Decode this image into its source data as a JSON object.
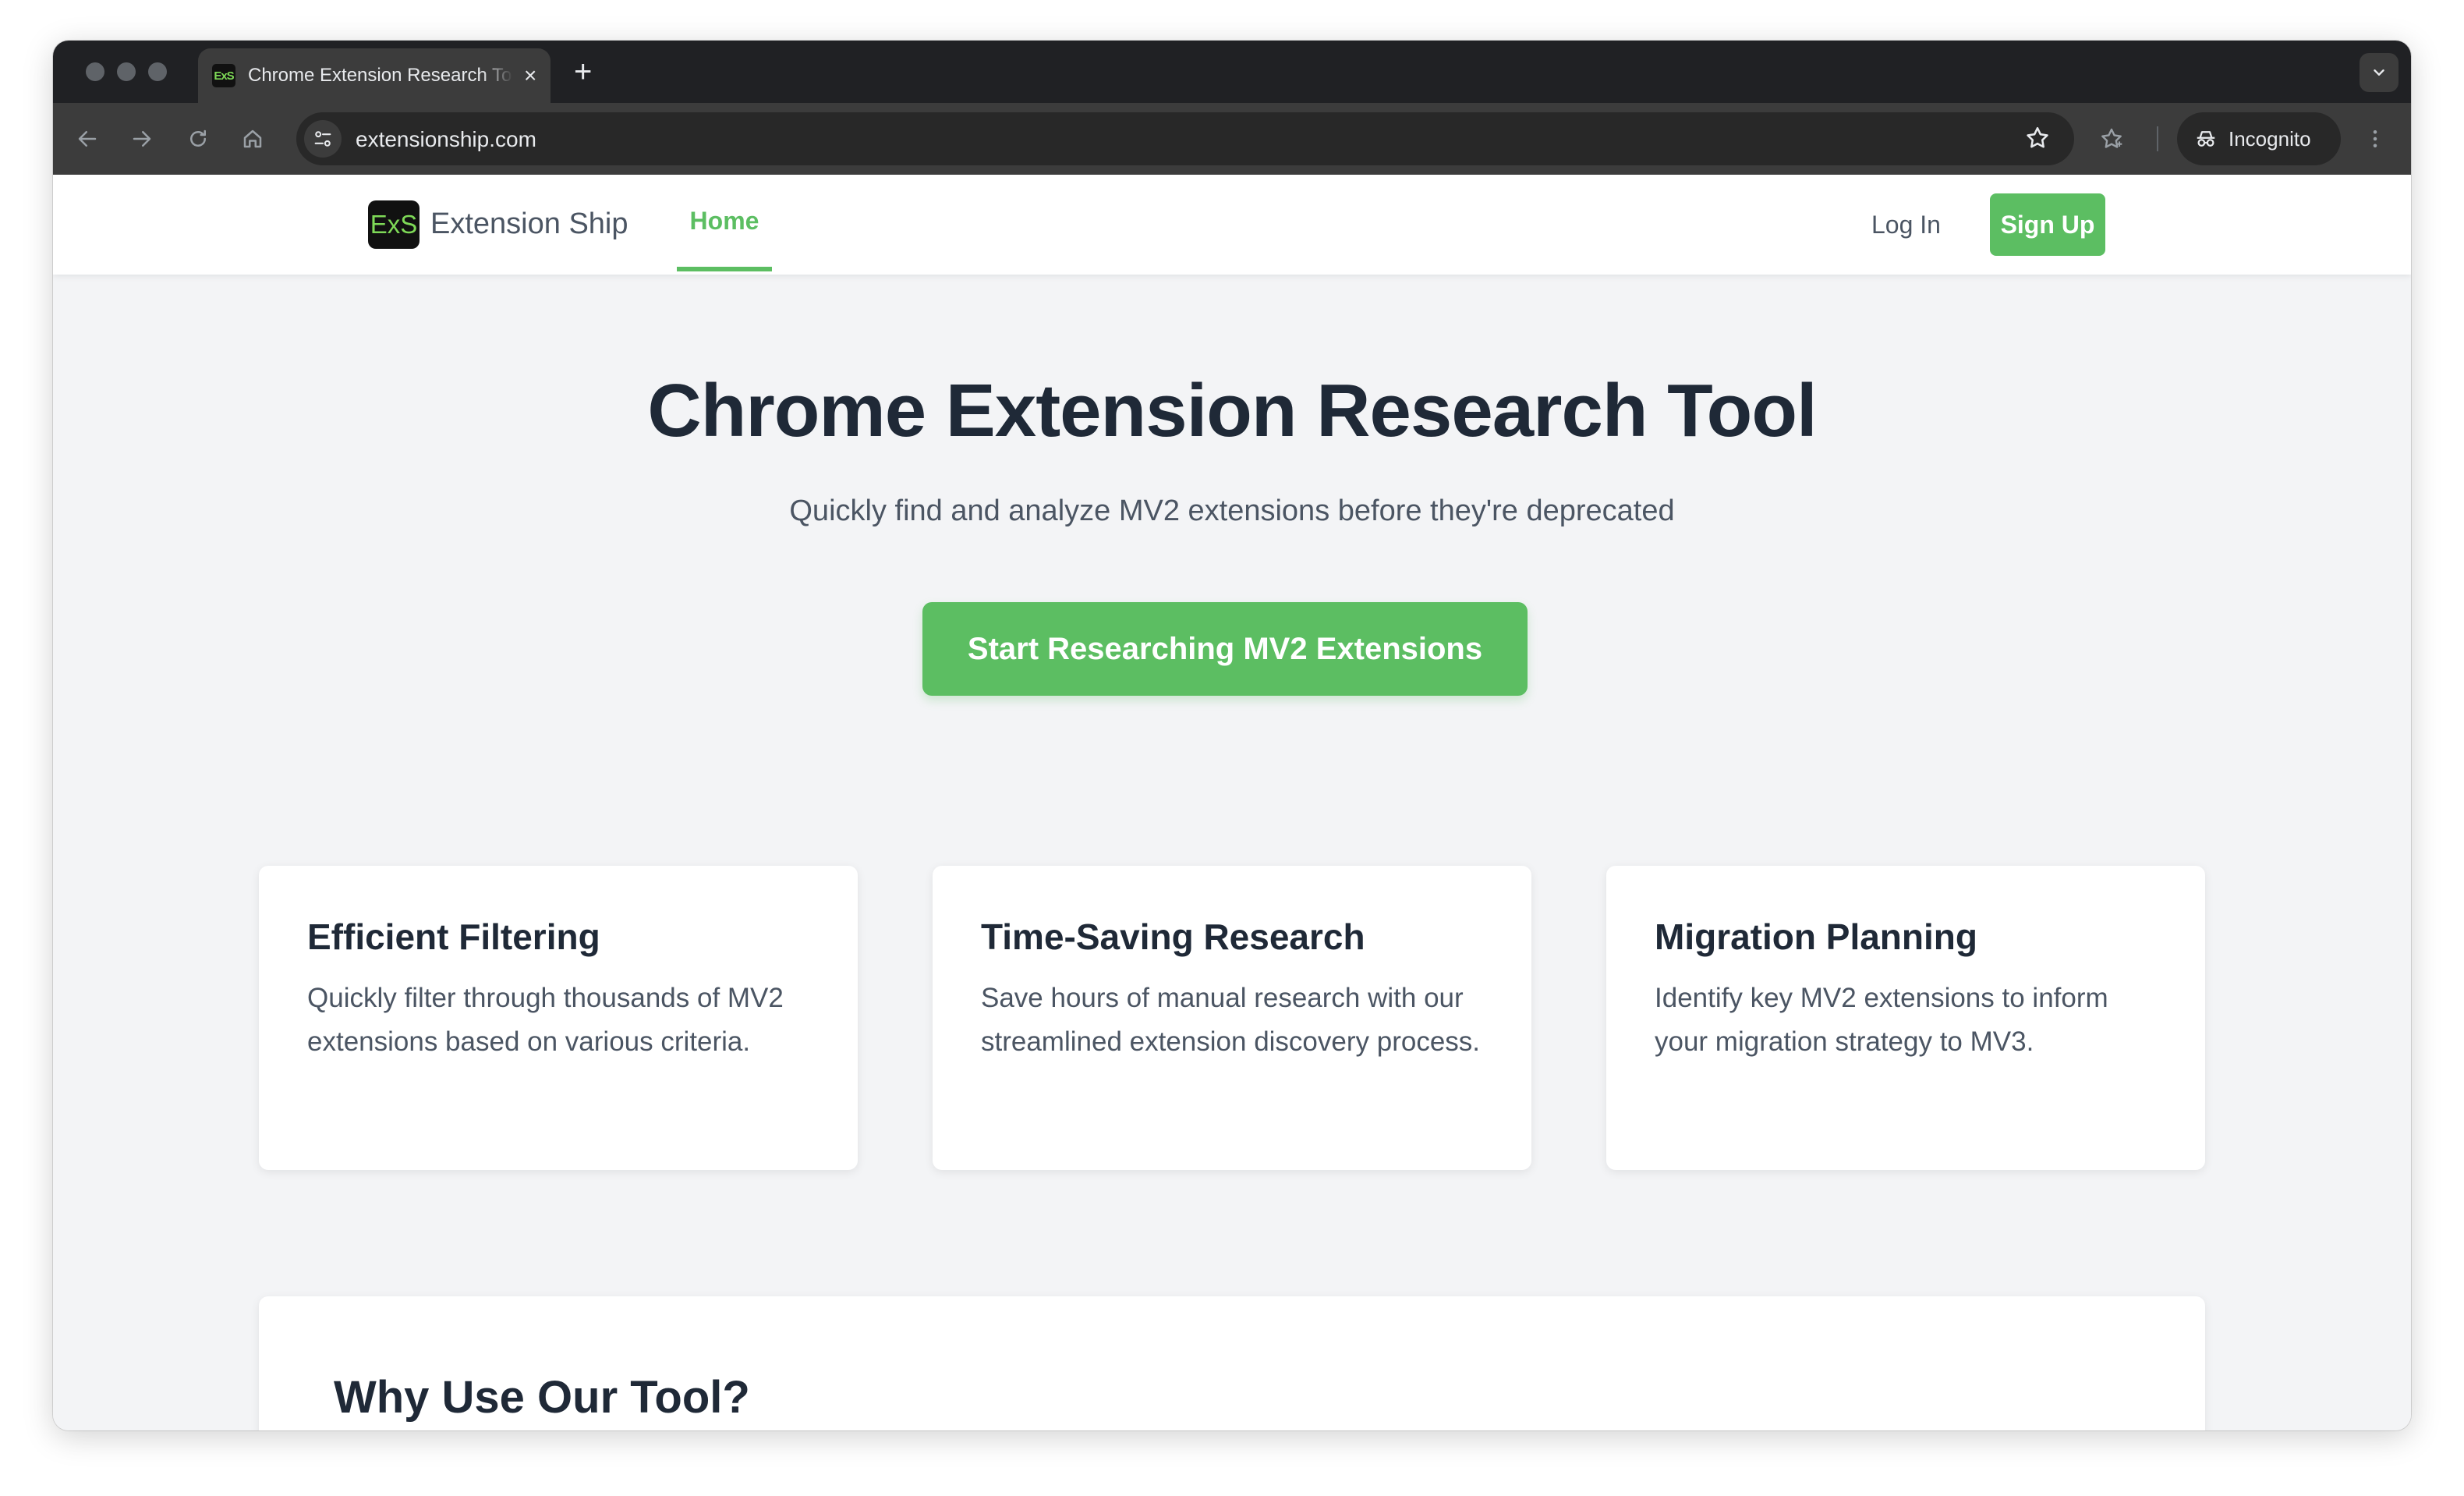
{
  "browser": {
    "tab": {
      "favicon_text": "ExS",
      "title": "Chrome Extension Research Tool",
      "close_glyph": "×"
    },
    "new_tab_glyph": "+",
    "url": "extensionship.com",
    "incognito_label": "Incognito",
    "icons": [
      "back-icon",
      "forward-icon",
      "reload-icon",
      "home-icon",
      "site-info-icon",
      "bookmark-star-icon",
      "extensions-star-icon",
      "incognito-icon",
      "more-menu-icon",
      "tab-search-icon"
    ]
  },
  "site": {
    "logo_mark": "ExS",
    "logo_text": "Extension Ship",
    "nav": {
      "home": "Home"
    },
    "auth": {
      "login": "Log In",
      "signup": "Sign Up"
    },
    "colors": {
      "accent": "#5cbe62",
      "heading": "#1f2937",
      "body": "#4b5563",
      "page_bg": "#f3f4f6"
    }
  },
  "hero": {
    "title": "Chrome Extension Research Tool",
    "subtitle": "Quickly find and analyze MV2 extensions before they're deprecated",
    "cta": "Start Researching MV2 Extensions"
  },
  "features": [
    {
      "title": "Efficient Filtering",
      "description": "Quickly filter through thousands of MV2 extensions based on various criteria."
    },
    {
      "title": "Time-Saving Research",
      "description": "Save hours of manual research with our streamlined extension discovery process."
    },
    {
      "title": "Migration Planning",
      "description": "Identify key MV2 extensions to inform your migration strategy to MV3."
    }
  ],
  "why": {
    "title": "Why Use Our Tool?"
  }
}
